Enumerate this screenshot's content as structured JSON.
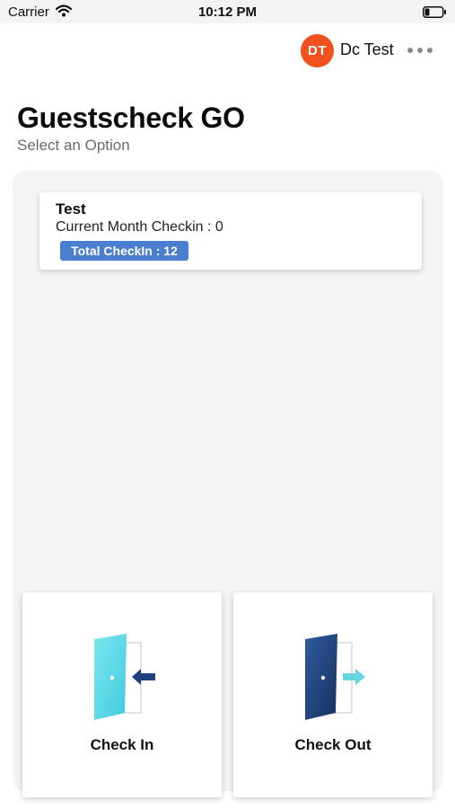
{
  "status_bar": {
    "carrier": "Carrier",
    "time": "10:12 PM"
  },
  "header": {
    "avatar_initials": "DT",
    "user_name": "Dc Test",
    "avatar_color": "#f0511e"
  },
  "title": "Guestscheck GO",
  "subtitle": "Select an Option",
  "location_card": {
    "name": "Test",
    "current_month": "Current Month Checkin : 0",
    "total_badge": "Total CheckIn : 12",
    "badge_color": "#4a7fd0"
  },
  "actions": [
    {
      "label": "Check In",
      "icon": "door-enter-icon",
      "color": "#5ad8e6"
    },
    {
      "label": "Check Out",
      "icon": "door-exit-icon",
      "color": "#213e78"
    }
  ]
}
